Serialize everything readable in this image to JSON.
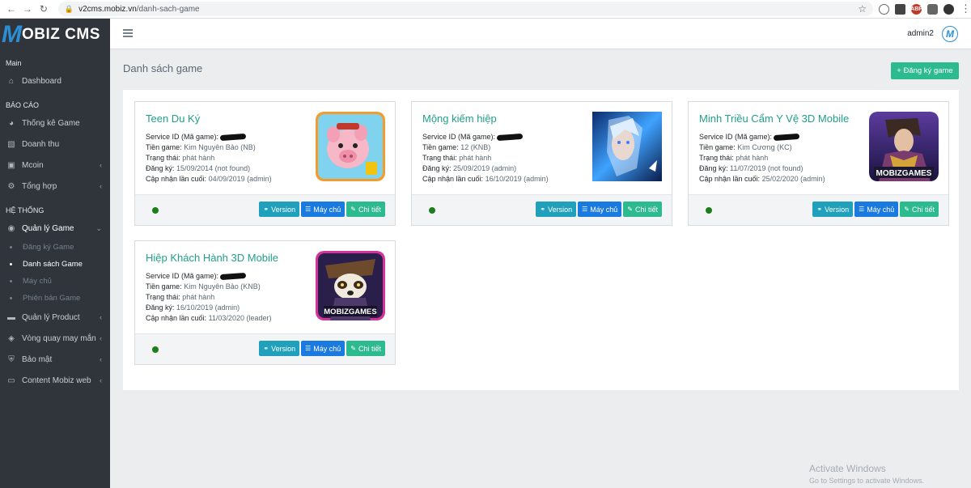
{
  "browser": {
    "url_host": "v2cms.mobiz.vn",
    "url_path": "/danh-sach-game"
  },
  "brand": {
    "logo_letter": "M",
    "title": "OBIZ CMS"
  },
  "header": {
    "user": "admin2",
    "logo_letter": "M"
  },
  "sidebar": {
    "sections": [
      {
        "title": "Main"
      },
      {
        "title": "BÁO CÁO"
      },
      {
        "title": "HỆ THỐNG"
      }
    ],
    "items": [
      {
        "label": "Dashboard",
        "icon": "home-icon"
      },
      {
        "label": "Thống kê Game",
        "icon": "pie-chart-icon"
      },
      {
        "label": "Doanh thu",
        "icon": "bar-chart-icon"
      },
      {
        "label": "Mcoin",
        "icon": "money-icon"
      },
      {
        "label": "Tổng hợp",
        "icon": "gear-icon"
      },
      {
        "label": "Quản lý Game",
        "icon": "gamepad-icon"
      },
      {
        "label": "Quản lý Product",
        "icon": "card-icon"
      },
      {
        "label": "Vòng quay may mắn",
        "icon": "palette-icon"
      },
      {
        "label": "Bảo mật",
        "icon": "shield-icon"
      },
      {
        "label": "Content Mobiz web",
        "icon": "desktop-icon"
      }
    ],
    "subitems": [
      {
        "label": "Đăng ký Game"
      },
      {
        "label": "Danh sách Game"
      },
      {
        "label": "Máy chủ"
      },
      {
        "label": "Phiên bản Game"
      }
    ]
  },
  "main": {
    "title": "Danh sách game",
    "add_button": "+ Đăng ký game",
    "labels": {
      "service_id": "Service ID (Mã game):",
      "currency": "Tiền game:",
      "status": "Trạng thái:",
      "registered": "Đăng ký:",
      "updated": "Cập nhận lần cuối:"
    },
    "buttons": {
      "version": "Version",
      "server": "Máy chủ",
      "detail": "Chi tiết"
    },
    "games": [
      {
        "name": "Teen Du Ký",
        "currency": "Kim Nguyên Bảo (NB)",
        "status": "phát hành",
        "registered": "15/09/2014 (not found)",
        "updated": "04/09/2019 (admin)"
      },
      {
        "name": "Mộng kiếm hiệp",
        "currency": "12 (KNB)",
        "status": "phát hành",
        "registered": "25/09/2019 (admin)",
        "updated": "16/10/2019 (admin)"
      },
      {
        "name": "Minh Triều Cẩm Y Vệ 3D Mobile",
        "currency": "Kim Cương (KC)",
        "status": "phát hành",
        "registered": "11/07/2019 (not found)",
        "updated": "25/02/2020 (admin)"
      },
      {
        "name": "Hiệp Khách Hành 3D Mobile",
        "currency": "Kim Nguyên Bảo (KNB)",
        "status": "phát hành",
        "registered": "16/10/2019 (admin)",
        "updated": "11/03/2020 (leader)"
      }
    ]
  },
  "watermark": {
    "line1": "Activate Windows",
    "line2": "Go to Settings to activate Windows."
  },
  "colors": {
    "sidebar": "#2f353a",
    "accent": "#20a089",
    "version": "#20a0bb",
    "server": "#1b7ae0",
    "detail": "#2dba8e"
  }
}
